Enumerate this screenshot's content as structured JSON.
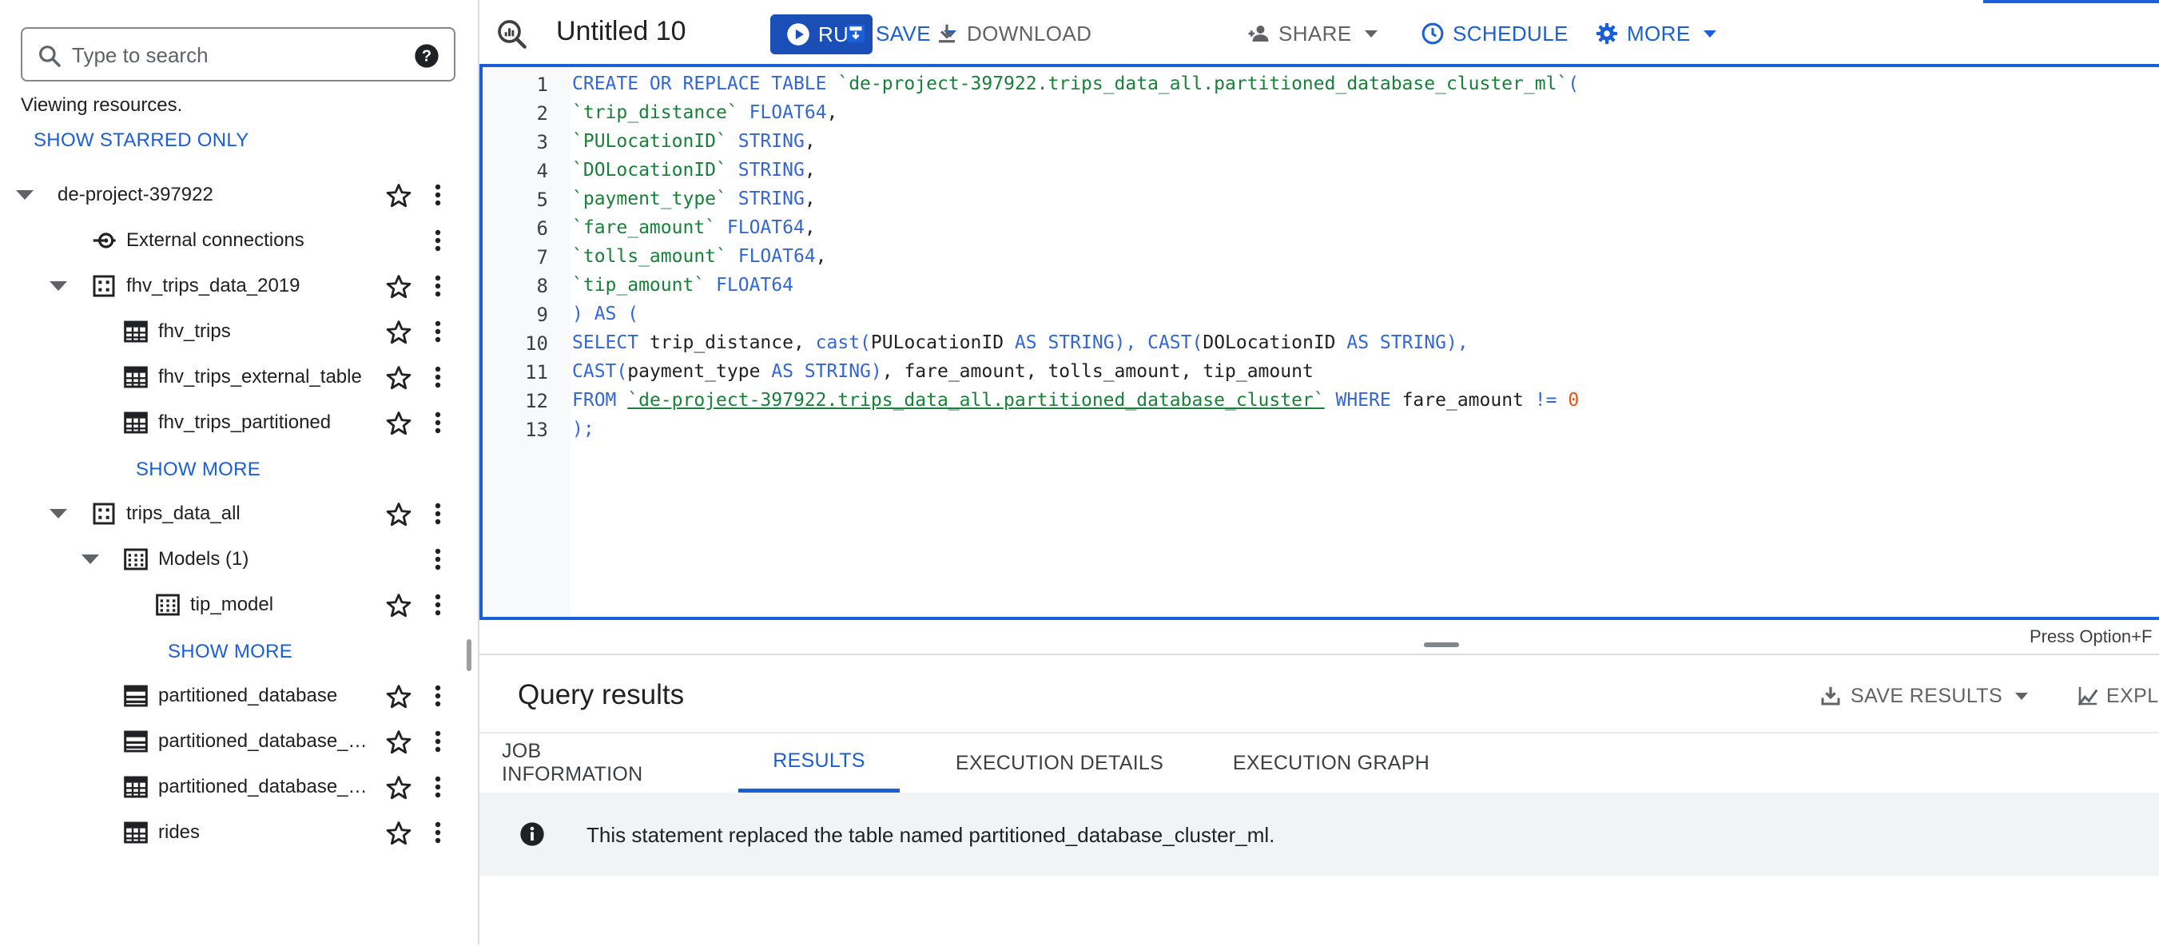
{
  "explorer": {
    "search_placeholder": "Type to search",
    "viewing_text": "Viewing resources.",
    "show_starred_label": "SHOW STARRED ONLY",
    "tree": [
      {
        "label": "de-project-397922",
        "icon": "project",
        "caret": true,
        "star": true
      },
      {
        "label": "External connections",
        "icon": "external-connection-icon",
        "caret": false,
        "star": false
      },
      {
        "label": "fhv_trips_data_2019",
        "icon": "dataset-icon",
        "caret": true,
        "star": true
      },
      {
        "label": "fhv_trips",
        "icon": "table-icon",
        "caret": false,
        "star": true
      },
      {
        "label": "fhv_trips_external_table",
        "icon": "table-icon",
        "caret": false,
        "star": true
      },
      {
        "label": "fhv_trips_partitioned",
        "icon": "table-icon",
        "caret": false,
        "star": true
      },
      {
        "label": "trips_data_all",
        "icon": "dataset-icon",
        "caret": true,
        "star": true
      },
      {
        "label": "Models (1)",
        "icon": "model-icon",
        "caret": true,
        "star": false
      },
      {
        "label": "tip_model",
        "icon": "model-icon",
        "caret": false,
        "star": true
      },
      {
        "label": "partitioned_database",
        "icon": "partitioned-table-icon",
        "caret": false,
        "star": true
      },
      {
        "label": "partitioned_database_cl...",
        "icon": "partitioned-table-icon",
        "caret": false,
        "star": true
      },
      {
        "label": "partitioned_database_cl...",
        "icon": "table-icon",
        "caret": false,
        "star": true
      },
      {
        "label": "rides",
        "icon": "table-icon",
        "caret": false,
        "star": true
      }
    ],
    "show_more_1": "SHOW MORE",
    "show_more_2": "SHOW MORE"
  },
  "toolbar": {
    "title": "Untitled 10",
    "run_label": "RUN",
    "save_label": "SAVE",
    "download_label": "DOWNLOAD",
    "share_label": "SHARE",
    "schedule_label": "SCHEDULE",
    "more_label": "MORE"
  },
  "editor": {
    "line_numbers": [
      "1",
      "2",
      "3",
      "4",
      "5",
      "6",
      "7",
      "8",
      "9",
      "10",
      "11",
      "12",
      "13"
    ],
    "lines": [
      [
        [
          "kw",
          "CREATE OR REPLACE TABLE "
        ],
        [
          "str",
          "`de-project-397922.trips_data_all.partitioned_database_cluster_ml`"
        ],
        [
          "kw",
          "("
        ]
      ],
      [
        [
          "str",
          "`trip_distance`"
        ],
        [
          "plain",
          " "
        ],
        [
          "kw",
          "FLOAT64"
        ],
        [
          "plain",
          ","
        ]
      ],
      [
        [
          "str",
          "`PULocationID`"
        ],
        [
          "plain",
          " "
        ],
        [
          "kw",
          "STRING"
        ],
        [
          "plain",
          ","
        ]
      ],
      [
        [
          "str",
          "`DOLocationID`"
        ],
        [
          "plain",
          " "
        ],
        [
          "kw",
          "STRING"
        ],
        [
          "plain",
          ","
        ]
      ],
      [
        [
          "str",
          "`payment_type`"
        ],
        [
          "plain",
          " "
        ],
        [
          "kw",
          "STRING"
        ],
        [
          "plain",
          ","
        ]
      ],
      [
        [
          "str",
          "`fare_amount`"
        ],
        [
          "plain",
          " "
        ],
        [
          "kw",
          "FLOAT64"
        ],
        [
          "plain",
          ","
        ]
      ],
      [
        [
          "str",
          "`tolls_amount`"
        ],
        [
          "plain",
          " "
        ],
        [
          "kw",
          "FLOAT64"
        ],
        [
          "plain",
          ","
        ]
      ],
      [
        [
          "str",
          "`tip_amount`"
        ],
        [
          "plain",
          " "
        ],
        [
          "kw",
          "FLOAT64"
        ]
      ],
      [
        [
          "kw",
          ") AS ("
        ]
      ],
      [
        [
          "kw",
          "SELECT"
        ],
        [
          "plain",
          " trip_distance, "
        ],
        [
          "kw",
          "cast("
        ],
        [
          "plain",
          "PULocationID "
        ],
        [
          "kw",
          "AS STRING"
        ],
        [
          "kw",
          "),"
        ],
        [
          "plain",
          " "
        ],
        [
          "kw",
          "CAST("
        ],
        [
          "plain",
          "DOLocationID "
        ],
        [
          "kw",
          "AS STRING"
        ],
        [
          "kw",
          "),"
        ]
      ],
      [
        [
          "kw",
          "CAST("
        ],
        [
          "plain",
          "payment_type "
        ],
        [
          "kw",
          "AS STRING"
        ],
        [
          "kw",
          ")"
        ],
        [
          "plain",
          ", fare_amount, tolls_amount, tip_amount"
        ]
      ],
      [
        [
          "kw",
          "FROM"
        ],
        [
          "plain",
          " "
        ],
        [
          "strul",
          "`de-project-397922.trips_data_all.partitioned_database_cluster`"
        ],
        [
          "plain",
          " "
        ],
        [
          "kw",
          "WHERE"
        ],
        [
          "plain",
          " fare_amount "
        ],
        [
          "kw",
          "!="
        ],
        [
          "plain",
          " "
        ],
        [
          "numlit",
          "0"
        ]
      ],
      [
        [
          "kw",
          ");"
        ]
      ]
    ],
    "hint": "Press Option+F"
  },
  "results": {
    "title": "Query results",
    "save_results_label": "SAVE RESULTS",
    "explore_label": "EXPL",
    "tabs": [
      "JOB INFORMATION",
      "RESULTS",
      "EXECUTION DETAILS",
      "EXECUTION GRAPH"
    ],
    "active_tab": "RESULTS",
    "message": "This statement replaced the table named partitioned_database_cluster_ml."
  },
  "colors": {
    "accent": "#1a5ed8",
    "run_button": "#1a4fb8",
    "keyword": "#3367d6",
    "string": "#188038",
    "number": "#e8541a"
  }
}
